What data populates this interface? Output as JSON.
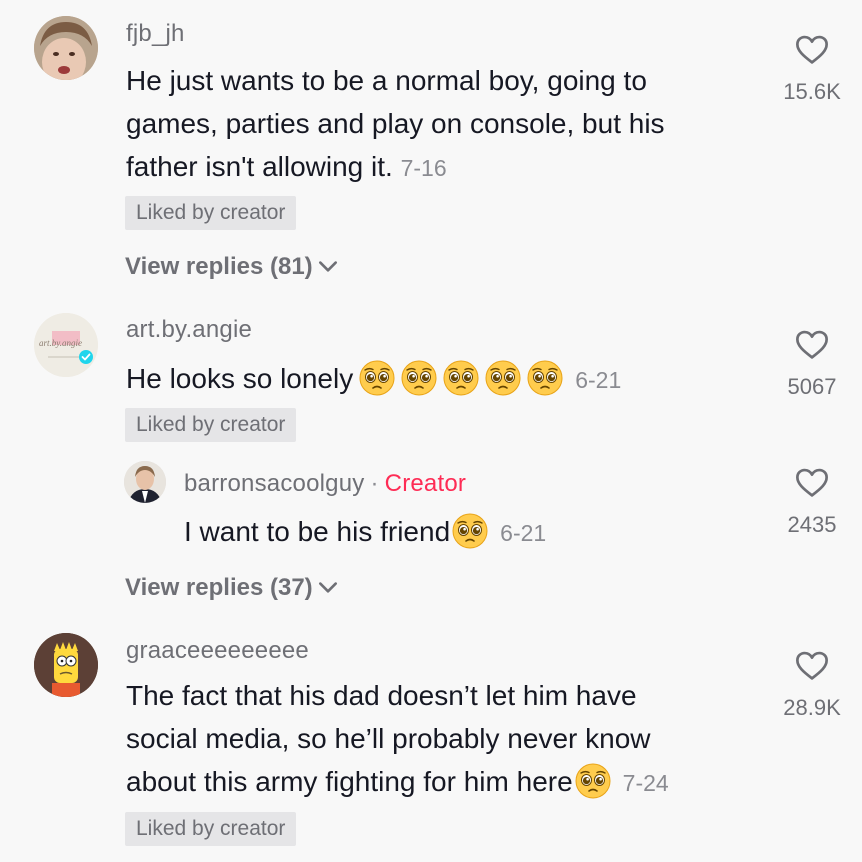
{
  "comments": [
    {
      "username": "fjb_jh",
      "text_lines": [
        "He just wants to be a normal boy, going to",
        "games, parties and play on console, but his",
        "father isn't allowing it."
      ],
      "date": "7-16",
      "badge": "Liked by creator",
      "likes": "15.6K",
      "view_replies": "View replies (81)"
    },
    {
      "username": "art.by.angie",
      "avatar_text": "art.by.angie",
      "text": "He looks so lonely",
      "emoji_count": 5,
      "date": "6-21",
      "badge": "Liked by creator",
      "likes": "5067",
      "reply": {
        "username": "barronsacoolguy",
        "separator": "·",
        "tag": "Creator",
        "text": "I want to be his friend",
        "date": "6-21",
        "likes": "2435"
      },
      "view_replies": "View replies (37)"
    },
    {
      "username": "graaceeeeeeeee",
      "text_lines": [
        "The fact that his dad doesn’t let him have",
        "social media, so he’ll probably never know",
        "about this army fighting for him here"
      ],
      "date": "7-24",
      "badge": "Liked by creator",
      "likes": "28.9K"
    }
  ],
  "icons": {
    "like": "heart-outline-icon",
    "expand": "chevron-down-icon",
    "emoji": "pleading-face-emoji",
    "verified": "verified-badge-icon"
  },
  "colors": {
    "background": "#f8f8f8",
    "creator_tag": "#fe2c55",
    "verified": "#20d5ec",
    "badge_bg": "#e5e5e7"
  }
}
